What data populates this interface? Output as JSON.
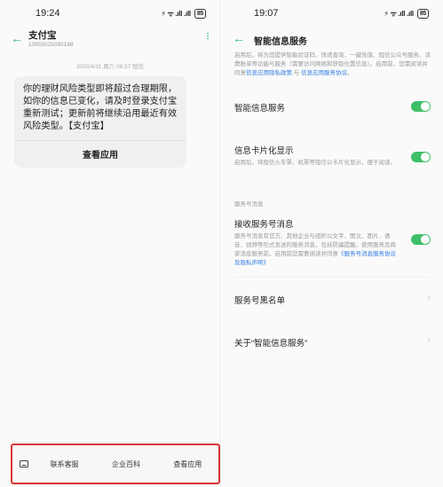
{
  "left": {
    "status": {
      "time": "19:24",
      "signal": "⚡ ᯤ .ıll .ıll",
      "battery": "85"
    },
    "header": {
      "title": "支付宝",
      "subtitle": "10655025095188"
    },
    "timestamp": "2020/4/11 周六 08:37 短信",
    "message": {
      "text": "你的理财风险类型即将超过合理期限，如你的信息已变化，请及时登录支付宝重新测试；更新前将继续沿用最近有效风险类型。【支付宝】",
      "action": "查看应用"
    },
    "bottom_menu": [
      "联系客服",
      "企业百科",
      "查看应用"
    ]
  },
  "right": {
    "status": {
      "time": "19:07",
      "signal": "⚡ ᯤ .ıll .ıll",
      "battery": "85"
    },
    "header": {
      "title": "智能信息服务"
    },
    "intro": {
      "text": "启用后，将为您提供智能验证码、快递查询、一键充值、短信公众号服务、话费账单等功能与服务（需要访问网络和获取位置信息）。启用前，您需阅读并同意",
      "link1": "信息应用隐私政策",
      "and": " 与 ",
      "link2": "信息应用服务协议",
      "end": "。"
    },
    "items": [
      {
        "title": "智能信息服务",
        "toggle": "on"
      },
      {
        "title": "信息卡片化显示",
        "desc": "启用后，将短信火车票、机票等短信以卡片化显示，便于阅读。",
        "toggle": "on"
      }
    ],
    "section": "服务号消息",
    "subscribe": {
      "title": "接收服务号消息",
      "desc": "服务号消息有官方、其他企业与组织以文字、图文、图片、语音、视频等形式发送的服务消息，包括防骗提醒。使用服务及商家消息服务前，启用前您需要阅读并同意",
      "link": "《服务号消息服务协议及隐私声明》",
      "toggle": "on"
    },
    "blacklist": "服务号黑名单",
    "about": "关于“智能信息服务”"
  }
}
